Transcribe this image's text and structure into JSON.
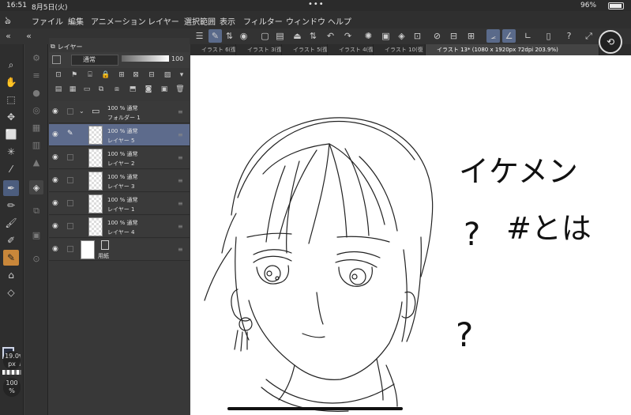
{
  "status": {
    "time": "16:51",
    "date": "8月5日(火)",
    "dots": "•••",
    "battery": "96%",
    "battery_level": 0.96
  },
  "menu": [
    "ファイル",
    "編集",
    "アニメーション",
    "レイヤー",
    "選択範囲",
    "表示",
    "フィルター",
    "ウィンドウ",
    "ヘルプ"
  ],
  "layer_panel": {
    "tab_label": "レイヤー",
    "blend_mode": "通常",
    "opacity": "100",
    "layers": [
      {
        "pct": "100 % 通常",
        "name": "フォルダー 1",
        "selected": false,
        "folder": true
      },
      {
        "pct": "100 % 通常",
        "name": "レイヤー 5",
        "selected": true
      },
      {
        "pct": "100 % 通常",
        "name": "レイヤー 2",
        "selected": false
      },
      {
        "pct": "100 % 通常",
        "name": "レイヤー 3",
        "selected": false
      },
      {
        "pct": "100 % 通常",
        "name": "レイヤー 1",
        "selected": false
      },
      {
        "pct": "100 % 通常",
        "name": "レイヤー 4",
        "selected": false
      },
      {
        "pct": "",
        "name": "用紙",
        "selected": false,
        "paper": true
      }
    ]
  },
  "tabs": [
    "イラスト 6(復元",
    "イラスト 3(復元",
    "イラスト 5(復元",
    "イラスト 4(復元",
    "イラスト 10(復",
    "イラスト 13* (1080 x 1920px 72dpi 203.9%)"
  ],
  "brush": {
    "size": "19.0",
    "size_unit": "px",
    "opacity": "100",
    "opacity_unit": "%"
  },
  "canvas_text": {
    "title": "イケメン",
    "q1": "?",
    "tag": "#とは",
    "q2": "?"
  },
  "colors": {
    "accent": "#5d6b8c",
    "orange_tool": "#c9873a",
    "main_color": "#2a3142"
  }
}
